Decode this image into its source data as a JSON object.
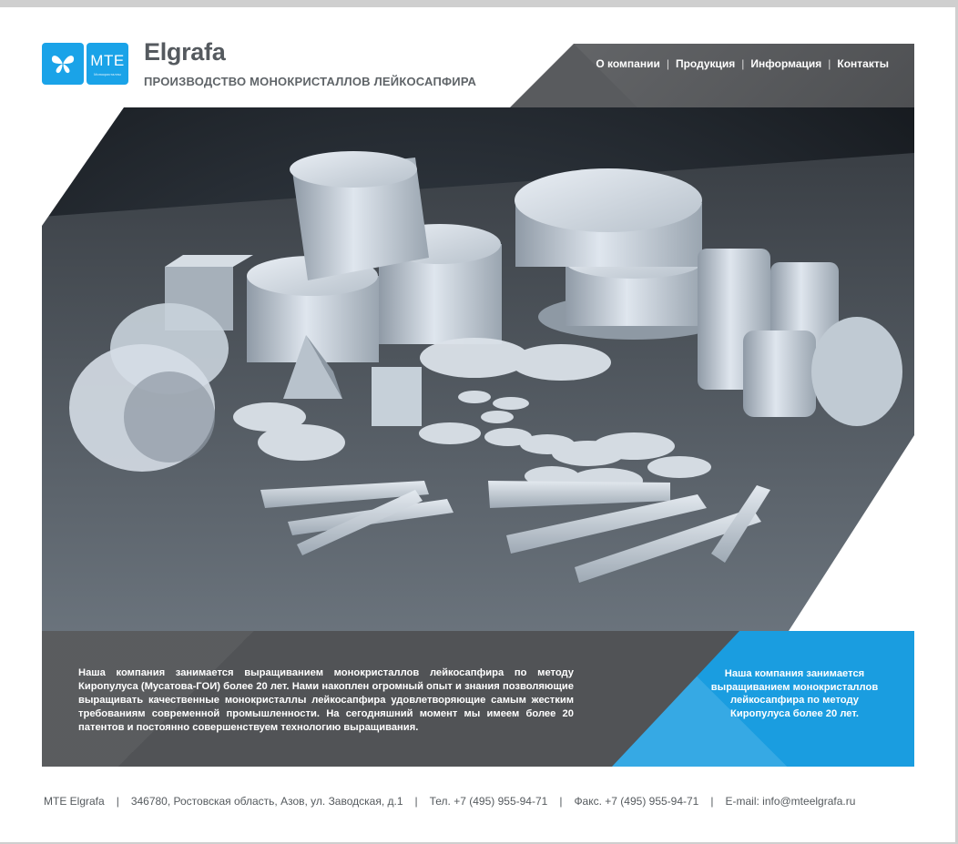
{
  "header": {
    "logo_text": "MTE",
    "logo_small": "Монокристаллы",
    "brand_name": "Elgrafa",
    "tagline": "ПРОИЗВОДСТВО МОНОКРИСТАЛЛОВ ЛЕЙКОСАПФИРА"
  },
  "nav": {
    "items": [
      {
        "label": "О компании"
      },
      {
        "label": "Продукция"
      },
      {
        "label": "Информация"
      },
      {
        "label": "Контакты"
      }
    ],
    "separator": "|"
  },
  "hero": {
    "image_icon": "crystal-products-photo"
  },
  "info": {
    "main_text": "Наша компания занимается выращиванием монокристаллов лейкосапфира по методу Киропулуса (Мусатова-ГОИ) более 20 лет. Нами накоплен огромный опыт и знания позволяющие выращивать качественные монокристаллы лейкосапфира удовлетворяющие самым жестким требованиям современной промышленности. На сегодняшний момент мы имеем более 20 патентов и постоянно совершенствуем технологию выращивания.",
    "highlight_text": "Наша компания занимается выращиванием монокристаллов лейкосапфира по методу Киропулуса более 20 лет."
  },
  "footer": {
    "company": "MTE Elgrafa",
    "address": "346780, Ростовская область, Азов, ул. Заводская, д.1",
    "phone": "Тел. +7 (495) 955-94-71",
    "fax": "Факс. +7 (495) 955-94-71",
    "email": "E-mail: info@mteelgrafa.ru",
    "separator": "|"
  },
  "colors": {
    "accent": "#1a9de0",
    "dark_panel": "#515356",
    "nav_bg": "#595b5e",
    "text": "#555a5e"
  }
}
